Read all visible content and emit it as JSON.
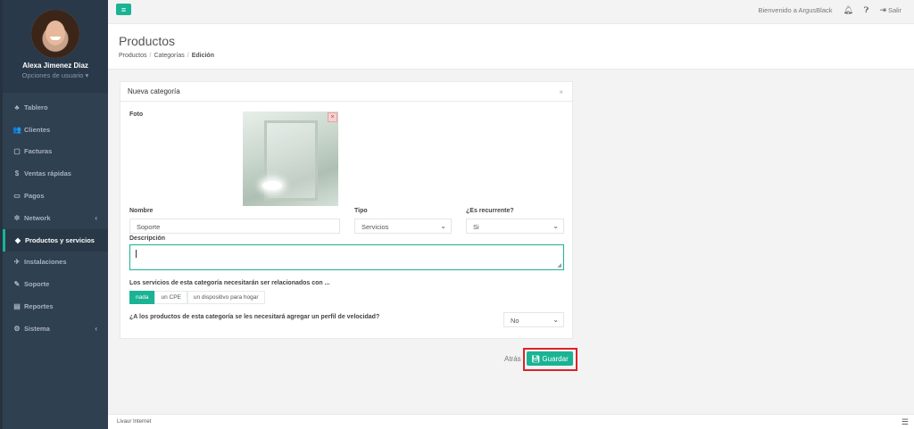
{
  "profile": {
    "name": "Alexa Jimenez Diaz",
    "options": "Opciones de usuario ▾"
  },
  "sidebar": {
    "items": [
      {
        "icon": "♣",
        "label": "Tablero"
      },
      {
        "icon": "👥",
        "label": "Clientes"
      },
      {
        "icon": "▢",
        "label": "Facturas"
      },
      {
        "icon": "$",
        "label": "Ventas rápidas"
      },
      {
        "icon": "▭",
        "label": "Pagos"
      },
      {
        "icon": "✲",
        "label": "Network"
      },
      {
        "icon": "◆",
        "label": "Productos y servicios"
      },
      {
        "icon": "✈",
        "label": "Instalaciones"
      },
      {
        "icon": "✎",
        "label": "Soporte"
      },
      {
        "icon": "▤",
        "label": "Reportes"
      },
      {
        "icon": "⚙",
        "label": "Sistema"
      }
    ]
  },
  "topbar": {
    "welcome": "Bienvenido a ArgusBlack",
    "logout": "Salir"
  },
  "header": {
    "title": "Productos",
    "crumb1": "Productos",
    "crumb2": "Categorías",
    "crumb3": "Edición"
  },
  "panel": {
    "title": "Nueva categoría",
    "photo_label": "Foto",
    "name_label": "Nombre",
    "name_value": "Soporte",
    "type_label": "Tipo",
    "type_value": "Servicios",
    "recurring_label": "¿Es recurrente?",
    "recurring_value": "Si",
    "desc_label": "Descripción",
    "relation_label": "Los servicios de esta categoría necesitarán ser relacionados con ...",
    "relation_options": [
      "nada",
      "un CPE",
      "un dispositivo para hogar"
    ],
    "speed_label": "¿A los productos de esta categoría se les necesitará agregar un perfil de velocidad?",
    "speed_value": "No"
  },
  "actions": {
    "back": "Atrás",
    "save": "Guardar"
  },
  "footer": {
    "text": "Livaur Internet"
  },
  "colors": {
    "accent": "#1ab394",
    "sidebar": "#2f4050",
    "highlight": "#e0202a"
  }
}
